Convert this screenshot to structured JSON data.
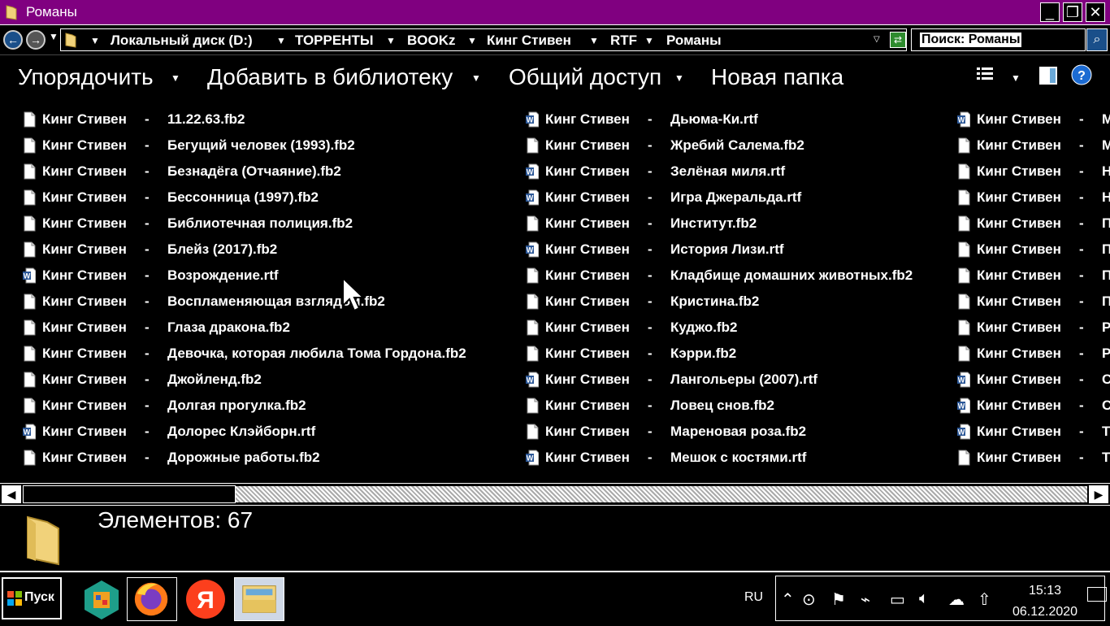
{
  "window": {
    "title": "Романы"
  },
  "address": {
    "crumbs": [
      "Локальный диск (D:)",
      "ТОРРЕНТЫ",
      "BOOKz",
      "Кинг Стивен",
      "RTF",
      "Романы"
    ]
  },
  "search": {
    "placeholder": "Поиск: Романы"
  },
  "toolbar": {
    "organize": "Упорядочить",
    "add_library": "Добавить в библиотеку",
    "share": "Общий доступ",
    "new_folder": "Новая папка"
  },
  "files": {
    "author": "Кинг Стивен",
    "dash": "-",
    "col1": [
      {
        "name": "11.22.63.fb2",
        "type": "fb2"
      },
      {
        "name": "Бегущий человек (1993).fb2",
        "type": "fb2"
      },
      {
        "name": "Безнадёга (Отчаяние).fb2",
        "type": "fb2"
      },
      {
        "name": "Бессонница (1997).fb2",
        "type": "fb2"
      },
      {
        "name": "Библиотечная полиция.fb2",
        "type": "fb2"
      },
      {
        "name": "Блейз (2017).fb2",
        "type": "fb2"
      },
      {
        "name": "Возрождение.rtf",
        "type": "rtf"
      },
      {
        "name": "Воспламеняющая взглядом.fb2",
        "type": "fb2"
      },
      {
        "name": "Глаза дракона.fb2",
        "type": "fb2"
      },
      {
        "name": "Девочка, которая любила Тома Гордона.fb2",
        "type": "fb2"
      },
      {
        "name": "Джойленд.fb2",
        "type": "fb2"
      },
      {
        "name": "Долгая прогулка.fb2",
        "type": "fb2"
      },
      {
        "name": "Долорес Клэйборн.rtf",
        "type": "rtf"
      },
      {
        "name": "Дорожные работы.fb2",
        "type": "fb2"
      }
    ],
    "col2": [
      {
        "name": "Дьюма-Ки.rtf",
        "type": "rtf"
      },
      {
        "name": "Жребий Салема.fb2",
        "type": "fb2"
      },
      {
        "name": "Зелёная миля.rtf",
        "type": "rtf"
      },
      {
        "name": "Игра Джеральда.rtf",
        "type": "rtf"
      },
      {
        "name": "Институт.fb2",
        "type": "fb2"
      },
      {
        "name": "История Лизи.rtf",
        "type": "rtf"
      },
      {
        "name": "Кладбище домашних животных.fb2",
        "type": "fb2"
      },
      {
        "name": "Кристина.fb2",
        "type": "fb2"
      },
      {
        "name": "Куджо.fb2",
        "type": "fb2"
      },
      {
        "name": "Кэрри.fb2",
        "type": "fb2"
      },
      {
        "name": "Лангольеры (2007).rtf",
        "type": "rtf"
      },
      {
        "name": "Ловец снов.fb2",
        "type": "fb2"
      },
      {
        "name": "Мареновая роза.fb2",
        "type": "fb2"
      },
      {
        "name": "Мешок с костями.rtf",
        "type": "rtf"
      }
    ],
    "col3": [
      {
        "name": "М",
        "type": "rtf"
      },
      {
        "name": "М",
        "type": "fb2"
      },
      {
        "name": "Н",
        "type": "fb2"
      },
      {
        "name": "Н",
        "type": "fb2"
      },
      {
        "name": "П",
        "type": "fb2"
      },
      {
        "name": "П",
        "type": "fb2"
      },
      {
        "name": "П",
        "type": "fb2"
      },
      {
        "name": "П",
        "type": "fb2"
      },
      {
        "name": "Р",
        "type": "fb2"
      },
      {
        "name": "Р",
        "type": "fb2"
      },
      {
        "name": "С",
        "type": "rtf"
      },
      {
        "name": "С",
        "type": "rtf"
      },
      {
        "name": "Т",
        "type": "rtf"
      },
      {
        "name": "Т",
        "type": "fb2"
      }
    ]
  },
  "details": {
    "count": "Элементов: 67"
  },
  "taskbar": {
    "start": "Пуск",
    "lang": "RU",
    "time": "15:13",
    "date": "06.12.2020",
    "apps": [
      "store-icon",
      "firefox-icon",
      "yandex-icon",
      "explorer-icon"
    ]
  }
}
